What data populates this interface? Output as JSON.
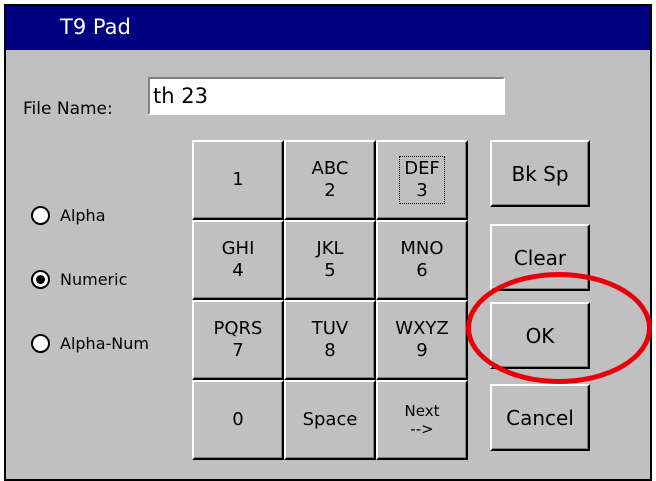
{
  "window": {
    "title": "T9 Pad"
  },
  "file_name": {
    "label": "File Name:",
    "value": "th 23"
  },
  "modes": [
    {
      "label": "Alpha",
      "selected": false
    },
    {
      "label": "Numeric",
      "selected": true
    },
    {
      "label": "Alpha-Num",
      "selected": false
    }
  ],
  "keypad": {
    "k1": {
      "digit": "1"
    },
    "k2": {
      "letters": "ABC",
      "digit": "2"
    },
    "k3": {
      "letters": "DEF",
      "digit": "3"
    },
    "k4": {
      "letters": "GHI",
      "digit": "4"
    },
    "k5": {
      "letters": "JKL",
      "digit": "5"
    },
    "k6": {
      "letters": "MNO",
      "digit": "6"
    },
    "k7": {
      "letters": "PQRS",
      "digit": "7"
    },
    "k8": {
      "letters": "TUV",
      "digit": "8"
    },
    "k9": {
      "letters": "WXYZ",
      "digit": "9"
    },
    "k0": {
      "digit": "0"
    },
    "space": "Space",
    "next": {
      "line1": "Next",
      "line2": "-->"
    }
  },
  "actions": {
    "backspace": "Bk Sp",
    "clear": "Clear",
    "ok": "OK",
    "cancel": "Cancel"
  },
  "annotation": {
    "shape": "ellipse",
    "color": "#e8000b",
    "target": "ok-button"
  }
}
